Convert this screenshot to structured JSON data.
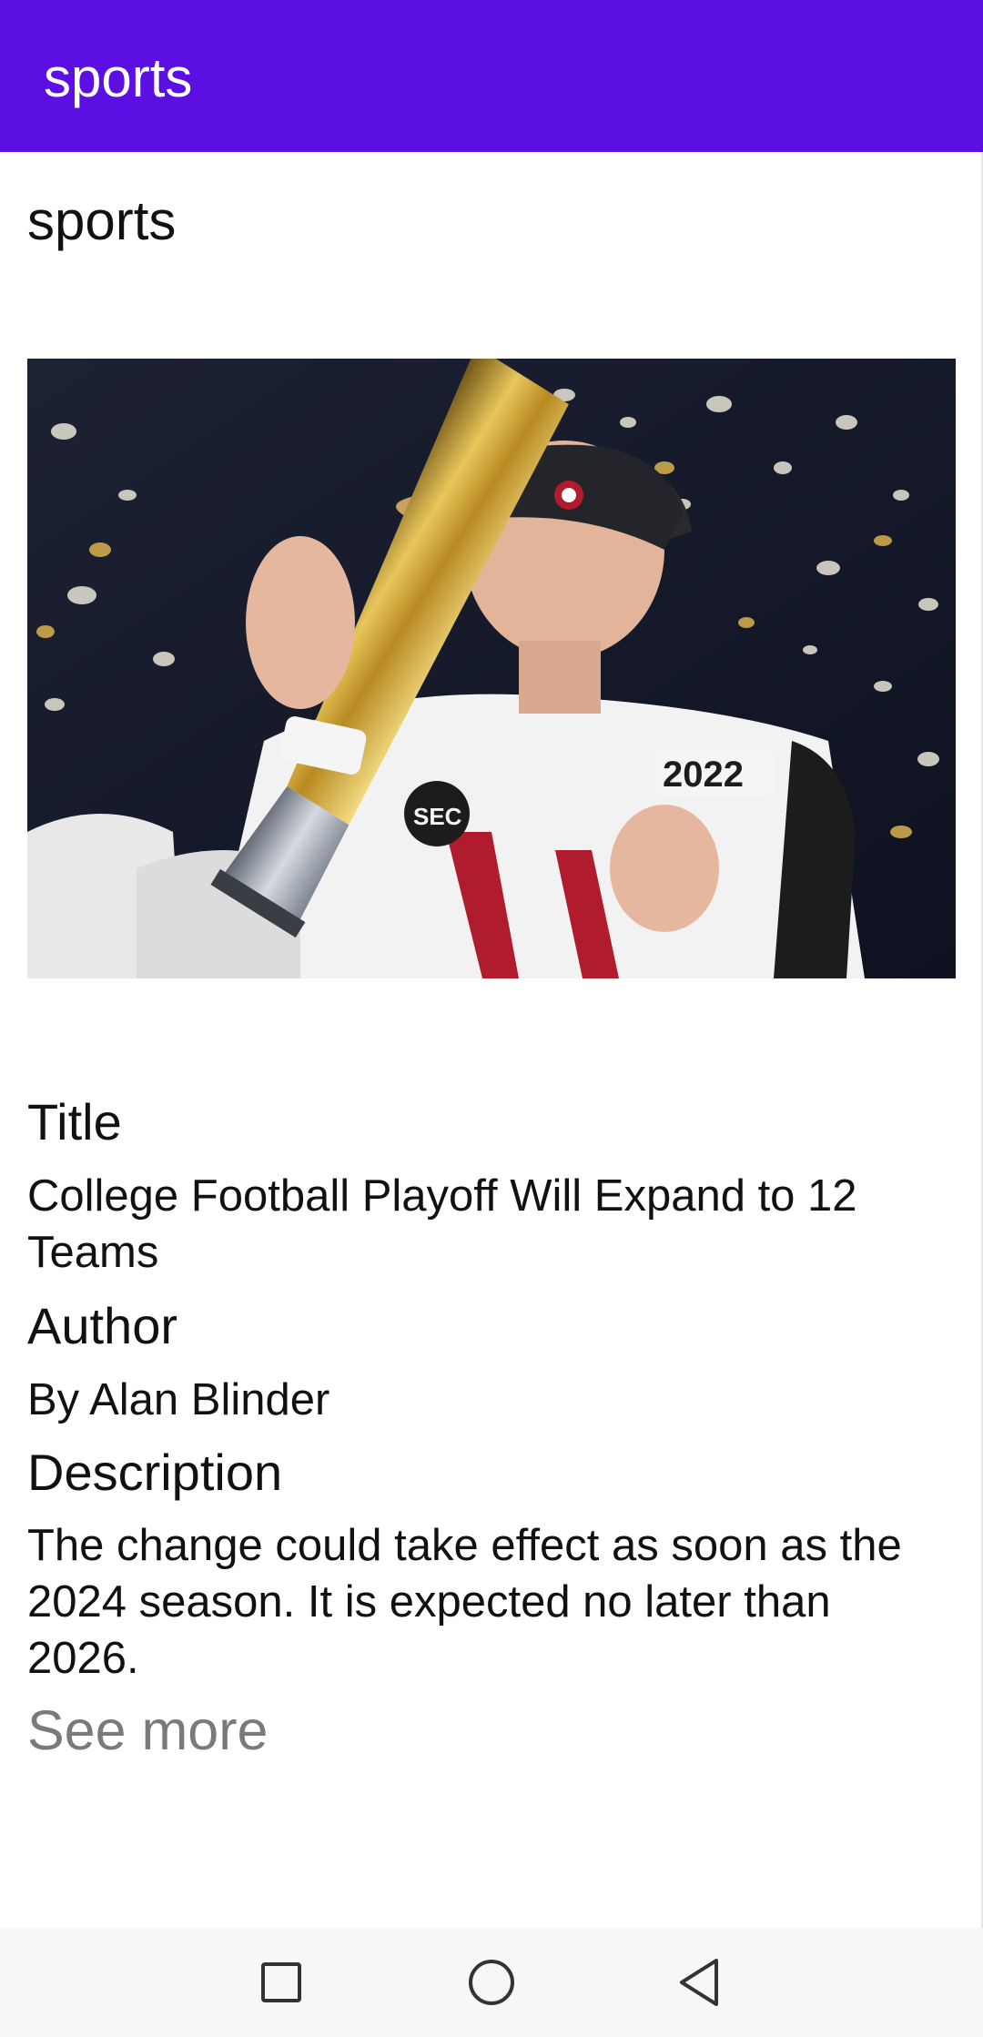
{
  "app_bar": {
    "title": "sports"
  },
  "content": {
    "category": "sports",
    "hero_image": {
      "icon": "article-photo"
    },
    "title_label": "Title",
    "title_value": "College Football Playoff Will Expand to 12 Teams",
    "author_label": "Author",
    "author_value": "By Alan Blinder",
    "description_label": "Description",
    "description_value": "The change could take effect as soon as the 2024 season. It is expected no later than 2026.",
    "see_more": "See more"
  },
  "nav_bar": {
    "recents_icon": "square-icon",
    "home_icon": "circle-icon",
    "back_icon": "triangle-back-icon"
  },
  "colors": {
    "app_bar": "#5b0fe2",
    "see_more": "#7a7a7a"
  }
}
